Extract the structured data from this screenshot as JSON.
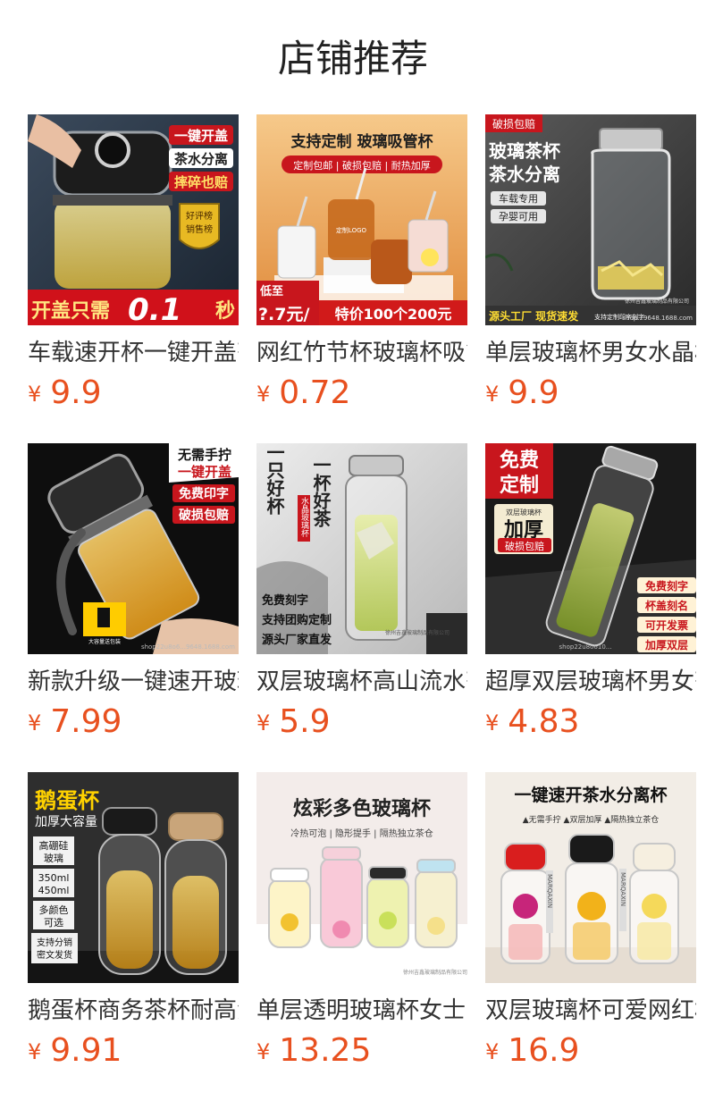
{
  "section": {
    "title": "店铺推荐"
  },
  "products": [
    {
      "name": "车载速开杯一键开盖茶水分离玻璃杯",
      "currency": "¥",
      "price": "9.9",
      "image": {
        "theme": "dark-tumbler",
        "bg": "#2b3848",
        "tags": [
          "一键开盖",
          "茶水分离",
          "摔碎也赔"
        ],
        "badge": [
          "好评榜",
          "销售榜"
        ],
        "banner": "开盖只需",
        "banner_big": "0.1",
        "banner_unit": "秒"
      }
    },
    {
      "name": "网红竹节杯玻璃杯吸管杯",
      "currency": "¥",
      "price": "0.72",
      "image": {
        "theme": "straw-cups",
        "bg": "#e89a4a",
        "heading": "支持定制  玻璃吸管杯",
        "sub": "定制包邮 | 破损包赔 | 耐热加厚",
        "cup_text": "定制LOGO",
        "left_tag": "低至",
        "left_price": "?.7元/",
        "banner": "特价100个200元"
      }
    },
    {
      "name": "单层玻璃杯男女水晶杯",
      "currency": "¥",
      "price": "9.9",
      "image": {
        "theme": "crystal-bottle",
        "bg": "#4a4a4a",
        "corner_tag": "破损包赔",
        "heading_lines": [
          "玻璃茶杯",
          "茶水分离"
        ],
        "tags": [
          "车载专用",
          "孕婴可用"
        ],
        "footer": "源头工厂  现货速发",
        "footer_small": "支持定制印字刻字",
        "watermark": "徐州吉鑫玻璃制品有限公司",
        "watermark2": "shop...9648.1688.com"
      }
    },
    {
      "name": "新款升级一键速开玻璃杯",
      "currency": "¥",
      "price": "7.99",
      "image": {
        "theme": "black-tumbler",
        "bg": "#111111",
        "corner_lines": [
          "无需手拧",
          "一键开盖"
        ],
        "tags": [
          "免费印字",
          "破损包赔"
        ],
        "small_label": "大容量送包装",
        "watermark": "shop22u8o6...9648.1688.com"
      }
    },
    {
      "name": "双层玻璃杯高山流水茶杯",
      "currency": "¥",
      "price": "5.9",
      "image": {
        "theme": "calligraphy",
        "bg": "#d9d9d9",
        "calli_left": "一只好杯",
        "calli_right": "一杯好茶",
        "stamp": "水晶玻璃杯",
        "lines": [
          "免费刻字",
          "支持团购定制",
          "源头厂家直发"
        ],
        "watermark": "徐州吉鑫玻璃制品有限公司"
      }
    },
    {
      "name": "超厚双层玻璃杯男女茶杯",
      "currency": "¥",
      "price": "4.83",
      "image": {
        "theme": "thick-glass",
        "bg": "#1c1c1c",
        "corner_lines": [
          "免费",
          "定制"
        ],
        "label_small": "双层玻璃杯",
        "label_big": "加厚",
        "label_red": "破损包赔",
        "tags": [
          "免费刻字",
          "杯盖刻名",
          "可开发票",
          "加厚双层"
        ],
        "watermark": "shop22u8o610..."
      }
    },
    {
      "name": "鹅蛋杯商务茶杯耐高温",
      "currency": "¥",
      "price": "9.91",
      "image": {
        "theme": "egg-cups",
        "bg": "#2e2e2e",
        "heading": "鹅蛋杯",
        "sub": "加厚大容量",
        "specs": [
          "高硼硅\n玻璃",
          "350ml\n450ml",
          "多颜色\n可选",
          "支持分销\n密文发货"
        ]
      }
    },
    {
      "name": "单层透明玻璃杯女士",
      "currency": "¥",
      "price": "13.25",
      "image": {
        "theme": "colorful-cups",
        "bg": "#f3ecea",
        "heading": "炫彩多色玻璃杯",
        "sub": "冷热可泡 | 隐形提手 | 隔热独立茶仓",
        "watermark": "徐州吉鑫玻璃制品有限公司"
      }
    },
    {
      "name": "双层玻璃杯可爱网红杯",
      "currency": "¥",
      "price": "16.9",
      "image": {
        "theme": "flower-cups",
        "bg": "#f2ede6",
        "heading": "一键速开茶水分离杯",
        "sub": "▲无需手拧  ▲双层加厚  ▲隔热独立茶仓",
        "strap_text": "MARQAXIN"
      }
    }
  ]
}
